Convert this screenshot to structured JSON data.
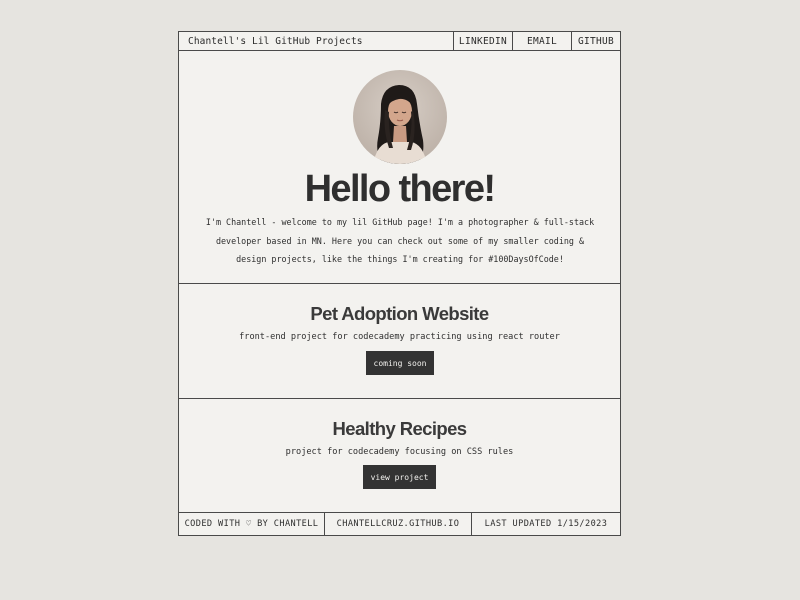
{
  "header": {
    "title": "Chantell's Lil GitHub Projects",
    "nav": [
      "LINKEDIN",
      "EMAIL",
      "GITHUB"
    ]
  },
  "hero": {
    "heading": "Hello there!",
    "intro": "I'm Chantell - welcome to my lil GitHub page! I'm a photographer & full-stack developer based in MN. Here you can check out some of my smaller coding & design projects, like the things I'm creating for #100DaysOfCode!"
  },
  "projects": [
    {
      "title": "Pet Adoption Website",
      "description": "front-end project for codecademy practicing using react router",
      "button": "coming soon"
    },
    {
      "title": "Healthy Recipes",
      "description": "project for codecademy focusing on CSS rules",
      "button": "view project"
    }
  ],
  "footer": {
    "credit": "CODED WITH ♡ BY CHANTELL",
    "site": "CHANTELLCRUZ.GITHUB.IO",
    "updated": "LAST UPDATED 1/15/2023"
  },
  "colors": {
    "page_background": "#e6e4e0",
    "card_background": "#f3f2ef",
    "text": "#2f2f2f",
    "button_background": "#333333",
    "border": "#4a4a4a"
  },
  "icons": [
    "heart-icon",
    "profile-photo"
  ]
}
